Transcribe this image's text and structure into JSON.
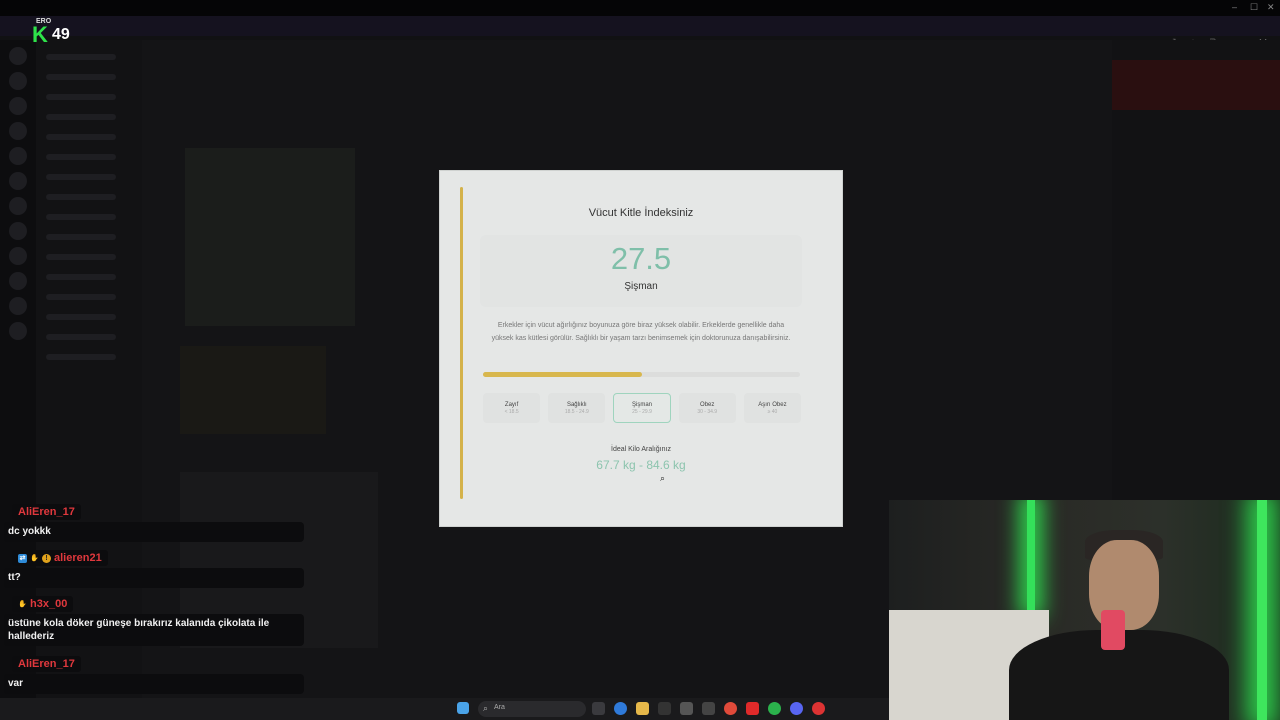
{
  "modal": {
    "title": "Vücut Kitle İndeksiniz",
    "bmi_value": "27.5",
    "category": "Şişman",
    "description": "Erkekler için vücut ağırlığınız boyunuza göre biraz yüksek olabilir. Erkeklerde genellikle daha yüksek kas kütlesi görülür. Sağlıklı bir yaşam tarzı benimsemek için doktorunuza danışabilirsiniz.",
    "progress_fraction": 0.5,
    "categories": [
      {
        "name": "Zayıf",
        "range": "< 18.5"
      },
      {
        "name": "Sağlıklı",
        "range": "18.5 - 24.9"
      },
      {
        "name": "Şişman",
        "range": "25 - 29.9",
        "active": true
      },
      {
        "name": "Obez",
        "range": "30 - 34.9"
      },
      {
        "name": "Aşırı Obez",
        "range": "≥ 40"
      }
    ],
    "ideal_label": "İdeal Kilo Aralığınız",
    "ideal_value": "67.7 kg - 84.6 kg"
  },
  "logo": {
    "tag": "ERO",
    "letter": "K",
    "number": "49"
  },
  "chat": [
    {
      "user": "AliEren_17",
      "text": "dc yokkk"
    },
    {
      "user": "alieren21",
      "text": "tt?"
    },
    {
      "user": "h3x_00",
      "text": "üstüne kola döker güneşe bırakırız kalanıda çikolata ile hallederiz"
    },
    {
      "user": "AliEren_17",
      "text": "var"
    },
    {
      "user": "alieren21",
      "text": ""
    }
  ],
  "taskbar": {
    "search_placeholder": "Ara"
  },
  "colors": {
    "accent_gold": "#d8b74d",
    "accent_green": "#7fbfa9",
    "chat_name": "#e0383d"
  }
}
